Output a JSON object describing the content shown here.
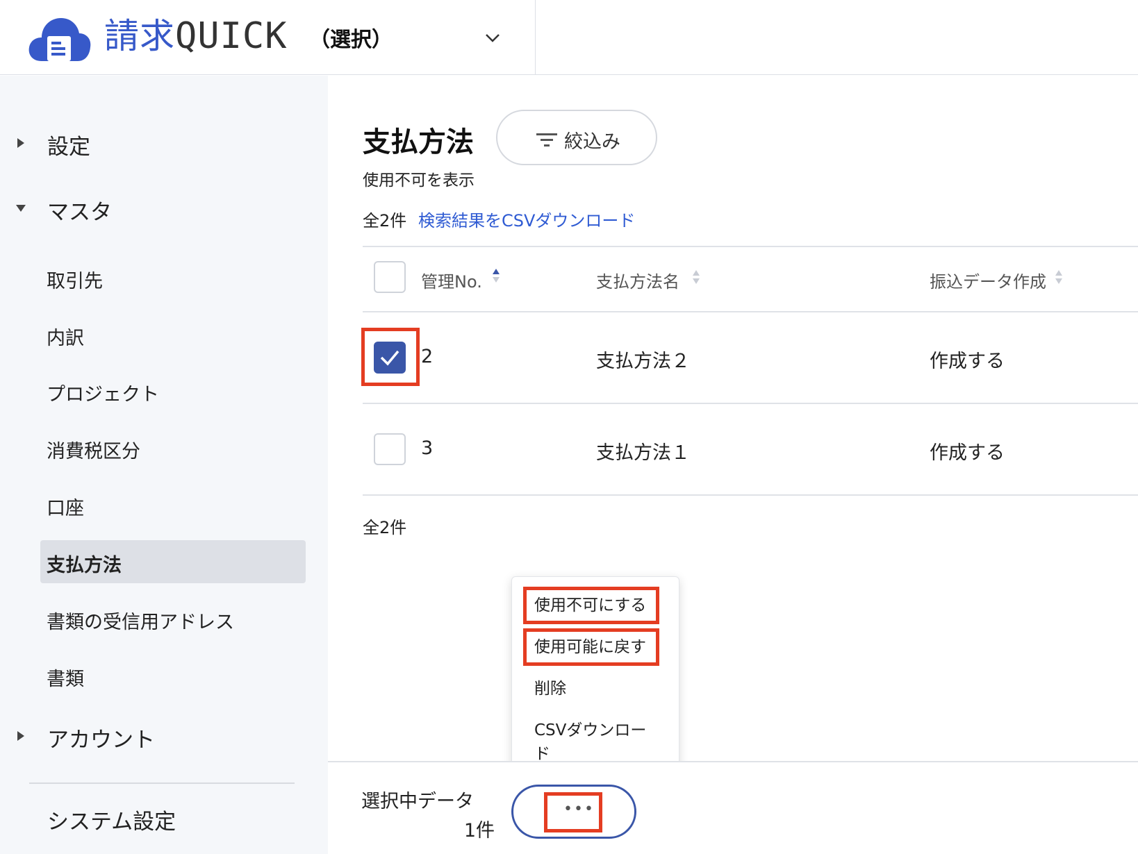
{
  "header": {
    "brand_name": "請求",
    "brand_suffix": "QUICK",
    "company_select": "（選択）"
  },
  "sidebar": {
    "groups": [
      {
        "label": "設定",
        "expanded": false
      },
      {
        "label": "マスタ",
        "expanded": true
      },
      {
        "label": "アカウント",
        "expanded": false
      }
    ],
    "items": [
      {
        "label": "取引先"
      },
      {
        "label": "内訳"
      },
      {
        "label": "プロジェクト"
      },
      {
        "label": "消費税区分"
      },
      {
        "label": "口座"
      },
      {
        "label": "支払方法",
        "active": true
      },
      {
        "label": "書類の受信用アドレス"
      },
      {
        "label": "書類"
      }
    ],
    "system_settings": "システム設定"
  },
  "main": {
    "title": "支払方法",
    "filter_label": "絞込み",
    "show_disabled": "使用不可を表示",
    "total_top": "全2件",
    "csv_link": "検索結果をCSVダウンロード",
    "total_bottom": "全2件"
  },
  "table": {
    "columns": [
      "管理No.",
      "支払方法名",
      "振込データ作成"
    ],
    "rows": [
      {
        "checked": true,
        "no": "2",
        "name": "支払方法２",
        "transfer": "作成する"
      },
      {
        "checked": false,
        "no": "3",
        "name": "支払方法１",
        "transfer": "作成する"
      }
    ]
  },
  "menu": {
    "items": [
      "使用不可にする",
      "使用可能に戻す",
      "削除",
      "CSVダウンロー",
      "ド"
    ]
  },
  "bottom_bar": {
    "selected_label": "選択中データ",
    "selected_count": "1件",
    "more_label": "•••"
  },
  "colors": {
    "accent": "#3a56a8",
    "link": "#2f5bd3",
    "highlight": "#e43d22",
    "sidebar_bg": "#f5f7fa"
  }
}
